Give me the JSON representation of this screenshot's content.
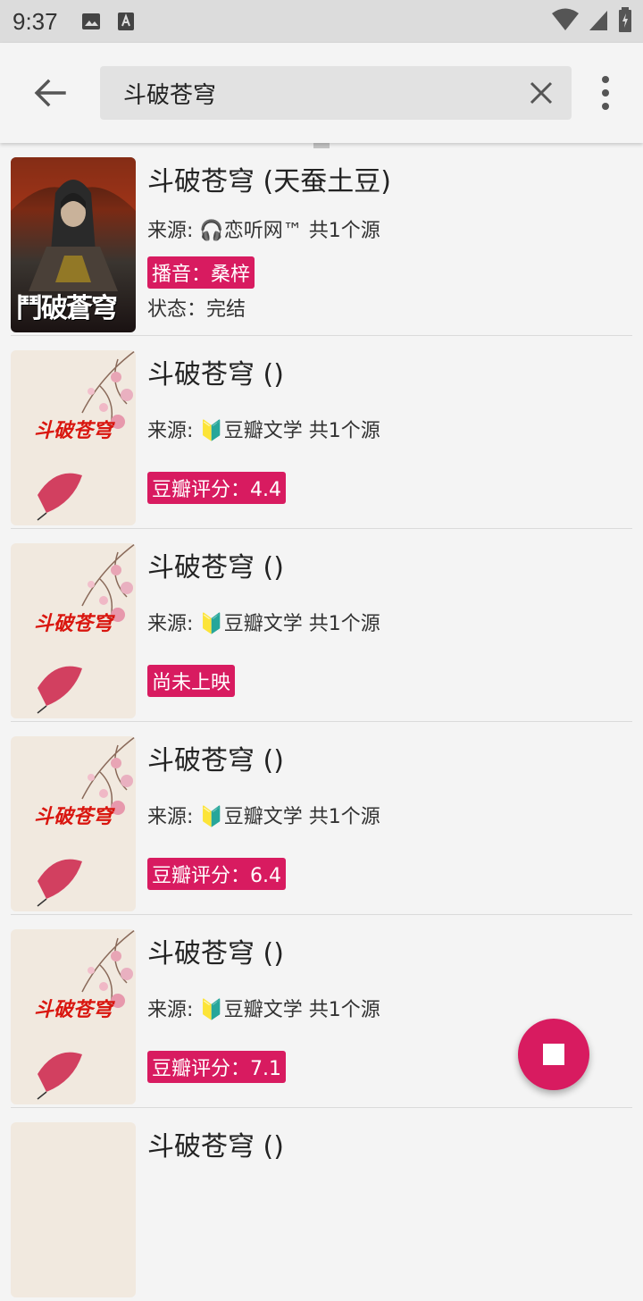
{
  "status": {
    "time": "9:37"
  },
  "search": {
    "query": "斗破苍穹"
  },
  "results": [
    {
      "title": "斗破苍穹 (天蚕土豆)",
      "source": "来源: 🎧恋听网™  共1个源",
      "tag": "播音：桑梓",
      "state": "状态：完结",
      "cover_text": "鬥破蒼穹",
      "cover_style": "dark"
    },
    {
      "title": "斗破苍穹 ()",
      "source": "来源: 🔰豆瓣文学  共1个源",
      "tag": "豆瓣评分：4.4",
      "cover_text": "斗破苍穹",
      "cover_style": "light"
    },
    {
      "title": "斗破苍穹 ()",
      "source": "来源: 🔰豆瓣文学  共1个源",
      "tag": "尚未上映",
      "cover_text": "斗破苍穹",
      "cover_style": "light"
    },
    {
      "title": "斗破苍穹 ()",
      "source": "来源: 🔰豆瓣文学  共1个源",
      "tag": "豆瓣评分：6.4",
      "cover_text": "斗破苍穹",
      "cover_style": "light"
    },
    {
      "title": "斗破苍穹 ()",
      "source": "来源: 🔰豆瓣文学  共1个源",
      "tag": "豆瓣评分：7.1",
      "cover_text": "斗破苍穹",
      "cover_style": "light"
    },
    {
      "title": "斗破苍穹 ()",
      "source": "",
      "tag": "",
      "cover_text": "",
      "cover_style": "light"
    }
  ],
  "icons": {
    "back": "arrow-back-icon",
    "clear": "close-icon",
    "menu": "more-vert-icon",
    "fab": "stop-icon"
  },
  "colors": {
    "accent": "#d81b60"
  }
}
